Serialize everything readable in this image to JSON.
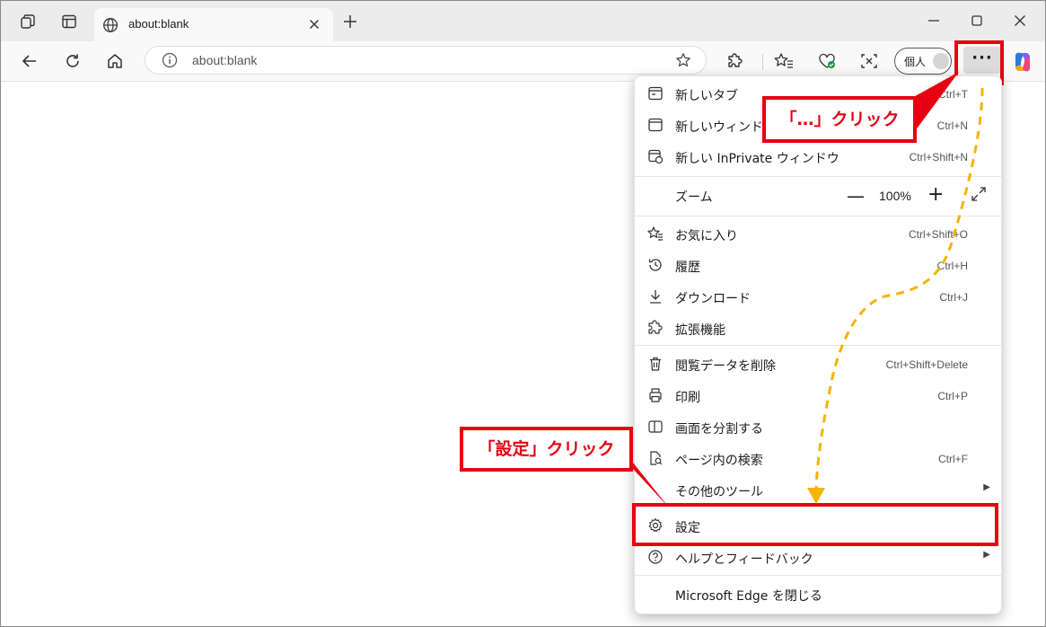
{
  "tab": {
    "title": "about:blank"
  },
  "address_bar": {
    "url": "about:blank"
  },
  "profile": {
    "label": "個人"
  },
  "more_button": {
    "label": "···"
  },
  "menu": {
    "new_tab": {
      "label": "新しいタブ",
      "shortcut": "Ctrl+T"
    },
    "new_window": {
      "label": "新しいウィンドウ",
      "shortcut": "Ctrl+N"
    },
    "new_inprivate": {
      "label": "新しい InPrivate ウィンドウ",
      "shortcut": "Ctrl+Shift+N"
    },
    "zoom": {
      "label": "ズーム",
      "minus": "—",
      "value": "100%",
      "plus": "+"
    },
    "favorites": {
      "label": "お気に入り",
      "shortcut": "Ctrl+Shift+O"
    },
    "history": {
      "label": "履歴",
      "shortcut": "Ctrl+H"
    },
    "downloads": {
      "label": "ダウンロード",
      "shortcut": "Ctrl+J"
    },
    "extensions": {
      "label": "拡張機能"
    },
    "clear_data": {
      "label": "閲覧データを削除",
      "shortcut": "Ctrl+Shift+Delete"
    },
    "print": {
      "label": "印刷",
      "shortcut": "Ctrl+P"
    },
    "split_screen": {
      "label": "画面を分割する"
    },
    "find_in_page": {
      "label": "ページ内の検索",
      "shortcut": "Ctrl+F"
    },
    "more_tools": {
      "label": "その他のツール"
    },
    "settings": {
      "label": "設定"
    },
    "help_feedback": {
      "label": "ヘルプとフィードバック"
    },
    "close_edge": {
      "label": "Microsoft Edge を閉じる"
    }
  },
  "annotations": {
    "callout_more": "「…」クリック",
    "callout_settings": "「設定」クリック",
    "highlight_color": "#e60012",
    "arrow_color": "#f5b400"
  }
}
